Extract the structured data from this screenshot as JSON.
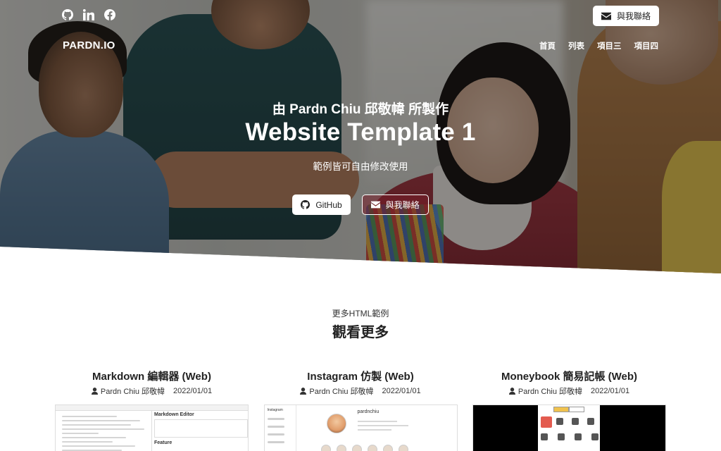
{
  "header": {
    "social": [
      {
        "icon": "github-icon",
        "label": "GitHub"
      },
      {
        "icon": "linkedin-icon",
        "label": "LinkedIn"
      },
      {
        "icon": "facebook-icon",
        "label": "Facebook"
      }
    ],
    "contact_button": "與我聯絡",
    "brand": "PARDN.IO",
    "nav": [
      "首頁",
      "列表",
      "項目三",
      "項目四"
    ]
  },
  "hero": {
    "subtitle": "由 Pardn Chiu 邱敬幃 所製作",
    "title": "Website Template 1",
    "description": "範例皆可自由修改使用",
    "github_button": "GitHub",
    "contact_button": "與我聯絡"
  },
  "more": {
    "subtitle": "更多HTML範例",
    "title": "觀看更多",
    "cards": [
      {
        "title": "Markdown 編輯器 (Web)",
        "author": "Pardn Chiu 邱敬幃",
        "date": "2022/01/01",
        "preview_heading": "Markdown Editor",
        "preview_feature": "Feature"
      },
      {
        "title": "Instagram 仿製 (Web)",
        "author": "Pardn Chiu 邱敬幃",
        "date": "2022/01/01",
        "preview_logo": "Instagram",
        "preview_user": "pardnchiu"
      },
      {
        "title": "Moneybook 簡易記帳 (Web)",
        "author": "Pardn Chiu 邱敬幃",
        "date": "2022/01/01"
      }
    ]
  },
  "colors": {
    "hero_overlay": "#141210",
    "contact_dark_button": "#781e28",
    "text_dark": "#222222"
  }
}
